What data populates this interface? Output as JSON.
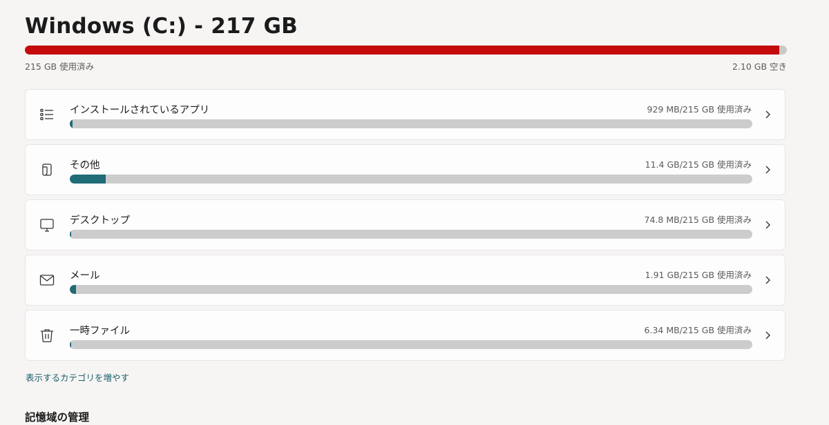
{
  "drive": {
    "title": "Windows (C:) - 217 GB",
    "used_label": "215 GB 使用済み",
    "free_label": "2.10 GB 空き",
    "used_fraction": 0.9903,
    "bar_color": "#c40a0a"
  },
  "categories": [
    {
      "name": "インストールされているアプリ",
      "usage": "929 MB/215 GB 使用済み",
      "fraction": 0.0042,
      "icon": "list-icon"
    },
    {
      "name": "その他",
      "usage": "11.4 GB/215 GB 使用済み",
      "fraction": 0.053,
      "icon": "other-files-icon"
    },
    {
      "name": "デスクトップ",
      "usage": "74.8 MB/215 GB 使用済み",
      "fraction": 0.0003,
      "icon": "monitor-icon"
    },
    {
      "name": "メール",
      "usage": "1.91 GB/215 GB 使用済み",
      "fraction": 0.0089,
      "icon": "mail-icon"
    },
    {
      "name": "一時ファイル",
      "usage": "6.34 MB/215 GB 使用済み",
      "fraction": 3e-05,
      "icon": "trash-icon"
    }
  ],
  "category_bar_color": "#1f6b76",
  "more_categories_link": "表示するカテゴリを増やす",
  "storage_management_heading": "記憶域の管理"
}
